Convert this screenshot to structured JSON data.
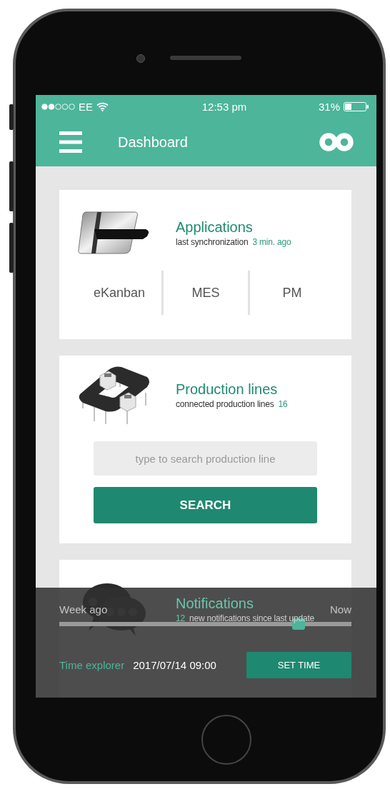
{
  "status_bar": {
    "carrier": "EE",
    "time": "12:53 pm",
    "battery": "31%"
  },
  "app_bar": {
    "title": "Dashboard"
  },
  "cards": [
    {
      "kind": "applications",
      "title": "Applications",
      "subtitle": "last synchronization",
      "value": "3 min. ago",
      "apps": [
        "eKanban",
        "MES",
        "PM"
      ]
    },
    {
      "kind": "production",
      "title": "Production lines",
      "subtitle": "connected production lines",
      "value": "16",
      "search": {
        "placeholder": "type to search production line"
      },
      "button": "SEARCH"
    },
    {
      "kind": "notifications",
      "title": "Notifications",
      "value": "12",
      "subtitle": "new notifications since last update"
    }
  ],
  "time_explorer": {
    "start_label": "Week ago",
    "end_label": "Now",
    "level": 0.82,
    "label": "Time explorer",
    "value": "2017/07/14 09:00",
    "button": "SET TIME"
  }
}
